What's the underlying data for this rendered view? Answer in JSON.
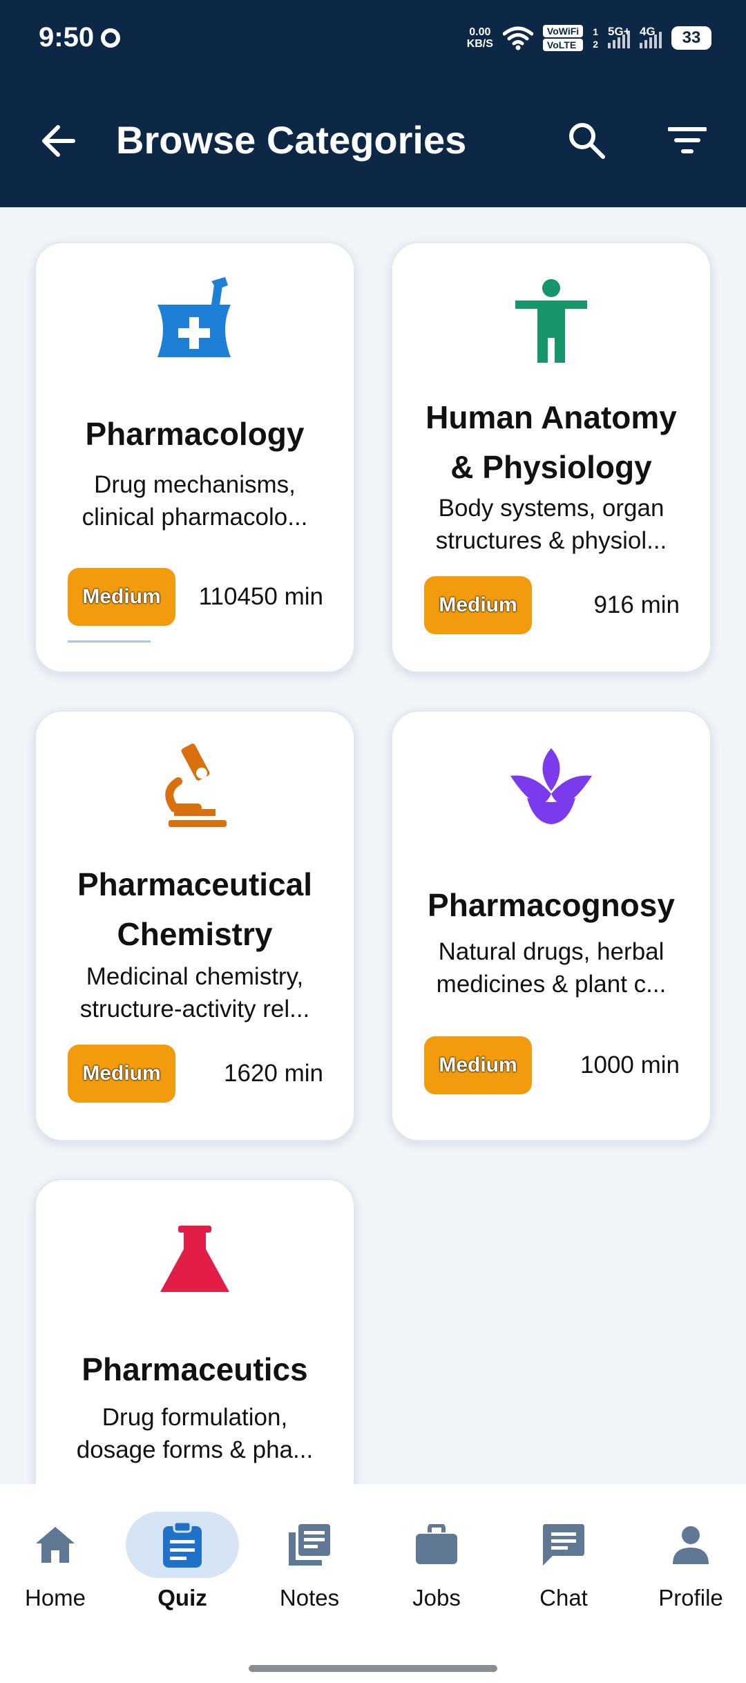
{
  "status_bar": {
    "time": "9:50",
    "net_speed_value": "0.00",
    "net_speed_unit": "KB/S",
    "vowifi": "VoWiFi",
    "volte": "VoLTE",
    "sim1": "1",
    "sim2": "2",
    "network1": "5G+",
    "network2": "4G",
    "battery": "33"
  },
  "header": {
    "title": "Browse Categories",
    "back_icon": "arrow-left-icon",
    "search_icon": "search-icon",
    "filter_icon": "filter-icon"
  },
  "categories": [
    {
      "title": "Pharmacology",
      "description_line1": "Drug mechanisms,",
      "description_line2": "clinical pharmacolo...",
      "difficulty": "Medium",
      "duration": "110450 min",
      "icon": "mortar-pestle-icon",
      "icon_color": "#1d80d6"
    },
    {
      "title_line1": "Human Anatomy",
      "title_line2": "& Physiology",
      "description_line1": "Body systems, organ",
      "description_line2": "structures & physiol...",
      "difficulty": "Medium",
      "duration": "916 min",
      "icon": "person-icon",
      "icon_color": "#17956a"
    },
    {
      "title_line1": "Pharmaceutical",
      "title_line2": "Chemistry",
      "description_line1": "Medicinal chemistry,",
      "description_line2": "structure-activity rel...",
      "difficulty": "Medium",
      "duration": "1620 min",
      "icon": "microscope-icon",
      "icon_color": "#d9700d"
    },
    {
      "title": "Pharmacognosy",
      "description_line1": "Natural drugs, herbal",
      "description_line2": "medicines & plant c...",
      "difficulty": "Medium",
      "duration": "1000 min",
      "icon": "leaf-icon",
      "icon_color": "#7c3aed"
    },
    {
      "title": "Pharmaceutics",
      "description_line1": "Drug formulation,",
      "description_line2": "dosage forms & pha...",
      "icon": "flask-icon",
      "icon_color": "#e11d48"
    }
  ],
  "bottom_nav": [
    {
      "label": "Home",
      "icon": "home-icon"
    },
    {
      "label": "Quiz",
      "icon": "clipboard-icon",
      "active": true
    },
    {
      "label": "Notes",
      "icon": "notes-icon"
    },
    {
      "label": "Jobs",
      "icon": "briefcase-icon"
    },
    {
      "label": "Chat",
      "icon": "chat-icon"
    },
    {
      "label": "Profile",
      "icon": "person-icon"
    }
  ],
  "colors": {
    "header_bg": "#0d2747",
    "page_bg": "#f1f4f9",
    "badge": "#f29b0c",
    "nav_icon": "#5f7894",
    "nav_active_icon": "#1f72c8",
    "nav_active_pill": "#d6e5f6"
  }
}
